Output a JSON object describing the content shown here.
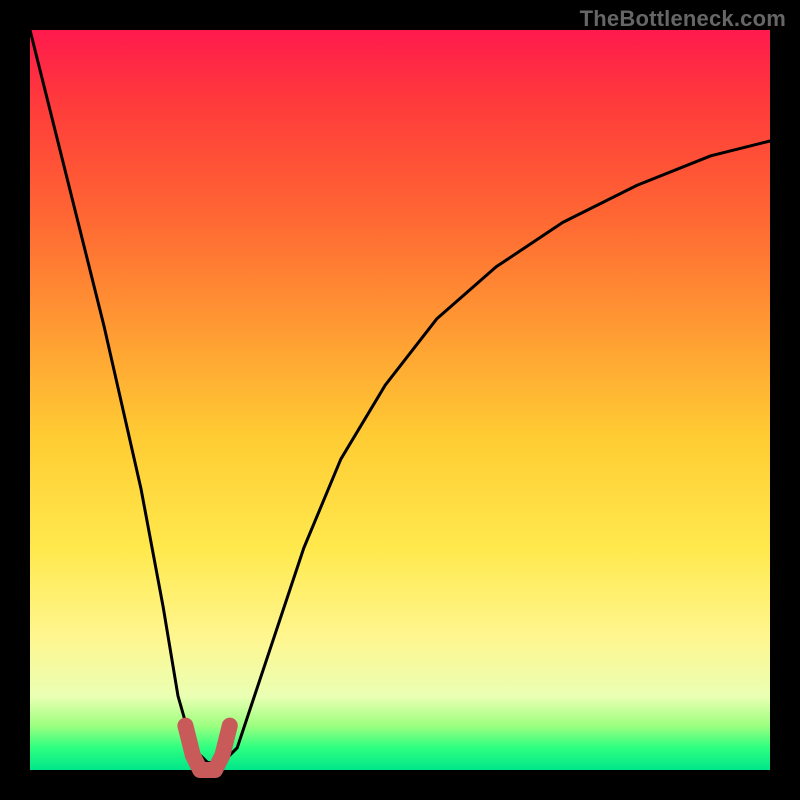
{
  "watermark": "TheBottleneck.com",
  "chart_data": {
    "type": "line",
    "title": "",
    "xlabel": "",
    "ylabel": "",
    "xlim": [
      0,
      100
    ],
    "ylim": [
      0,
      100
    ],
    "series": [
      {
        "name": "bottleneck-curve",
        "x": [
          0,
          5,
          10,
          15,
          18,
          20,
          22,
          24,
          25,
          26,
          28,
          30,
          33,
          37,
          42,
          48,
          55,
          63,
          72,
          82,
          92,
          100
        ],
        "values": [
          100,
          80,
          60,
          38,
          22,
          10,
          3,
          1,
          1,
          1,
          3,
          9,
          18,
          30,
          42,
          52,
          61,
          68,
          74,
          79,
          83,
          85
        ]
      },
      {
        "name": "highlight-bucket",
        "x": [
          21,
          22,
          23,
          24,
          25,
          26,
          27
        ],
        "values": [
          6,
          2,
          0,
          0,
          0,
          2,
          6
        ]
      }
    ],
    "colors": {
      "curve": "#000000",
      "highlight": "#c85a5a"
    }
  }
}
